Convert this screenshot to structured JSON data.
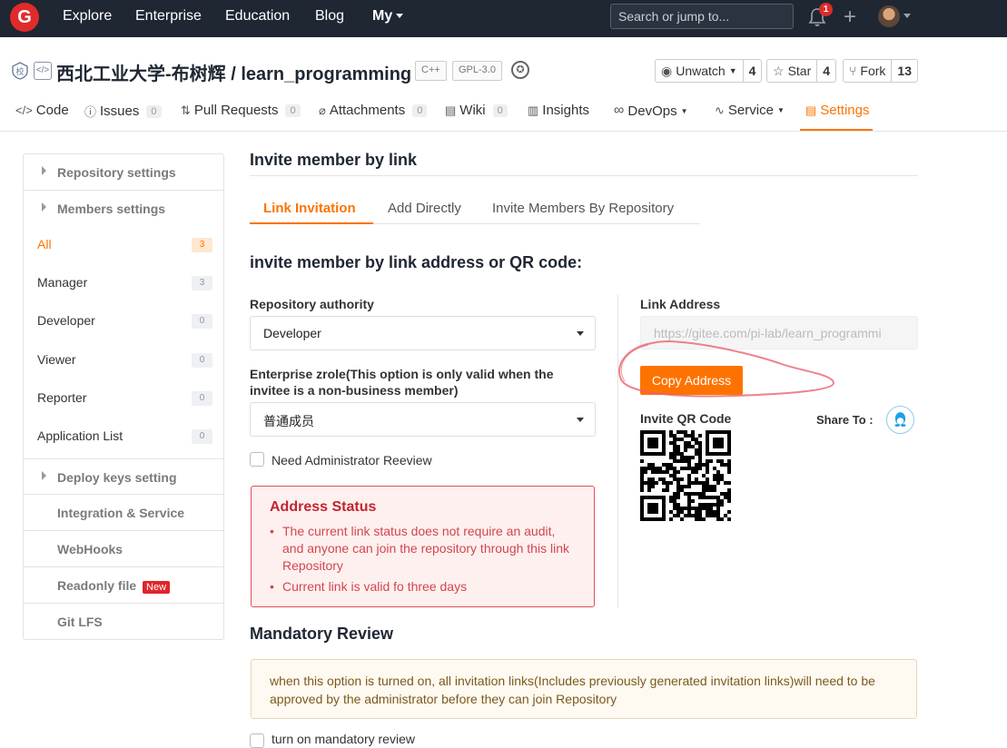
{
  "nav": {
    "logo": "G",
    "links": [
      "Explore",
      "Enterprise",
      "Education",
      "Blog",
      "My"
    ],
    "search_placeholder": "Search or jump to...",
    "notifications": "1"
  },
  "repo": {
    "owner_icon": "校",
    "title": "西北工业大学-布树辉 / learn_programming",
    "lang_tag": "C++",
    "license_tag": "GPL-3.0",
    "watch_label": "Unwatch",
    "watch_count": "4",
    "star_label": "Star",
    "star_count": "4",
    "fork_label": "Fork",
    "fork_count": "13"
  },
  "repo_tabs": [
    {
      "label": "Code"
    },
    {
      "label": "Issues",
      "count": "0"
    },
    {
      "label": "Pull Requests",
      "count": "0"
    },
    {
      "label": "Attachments",
      "count": "0"
    },
    {
      "label": "Wiki",
      "count": "0"
    },
    {
      "label": "Insights"
    },
    {
      "label": "DevOps"
    },
    {
      "label": "Service"
    },
    {
      "label": "Settings"
    }
  ],
  "sidebar": {
    "repository_settings": "Repository settings",
    "members_settings": "Members settings",
    "members": [
      {
        "label": "All",
        "count": "3"
      },
      {
        "label": "Manager",
        "count": "3"
      },
      {
        "label": "Developer",
        "count": "0"
      },
      {
        "label": "Viewer",
        "count": "0"
      },
      {
        "label": "Reporter",
        "count": "0"
      },
      {
        "label": "Application List",
        "count": "0"
      }
    ],
    "deploy_keys": "Deploy keys setting",
    "integration": "Integration & Service",
    "webhooks": "WebHooks",
    "readonly": "Readonly file",
    "new_badge": "New",
    "git_lfs": "Git LFS"
  },
  "main": {
    "title": "Invite member by link",
    "tabs": [
      "Link Invitation",
      "Add Directly",
      "Invite Members By Repository"
    ],
    "subtitle": "invite member by link address or QR code:",
    "authority_label": "Repository authority",
    "authority_value": "Developer",
    "enterprise_label": "Enterprise zrole(This option is only valid when the invitee is a non-business member)",
    "enterprise_value": "普通成员",
    "review_label": "Need Administrator Reeview",
    "status_title": "Address Status",
    "status_items": [
      "The current link status does not require an audit, and anyone can join the repository through this link Repository",
      "Current link is valid fo three days"
    ],
    "link_label": "Link Address",
    "link_value": "https://gitee.com/pi-lab/learn_programmi",
    "copy_button": "Copy Address",
    "qr_label": "Invite QR Code",
    "share_label": "Share To :",
    "mandatory_title": "Mandatory Review",
    "mandatory_text": "when this option is turned on, all invitation links(Includes previously generated invitation links)will need to be approved by the administrator before they can join Repository",
    "mandatory_check": "turn on mandatory review"
  },
  "colors": {
    "accent": "#fe7300",
    "nav_bg": "#1f2733",
    "danger": "#c0262d",
    "annotation": "#e8636e"
  }
}
